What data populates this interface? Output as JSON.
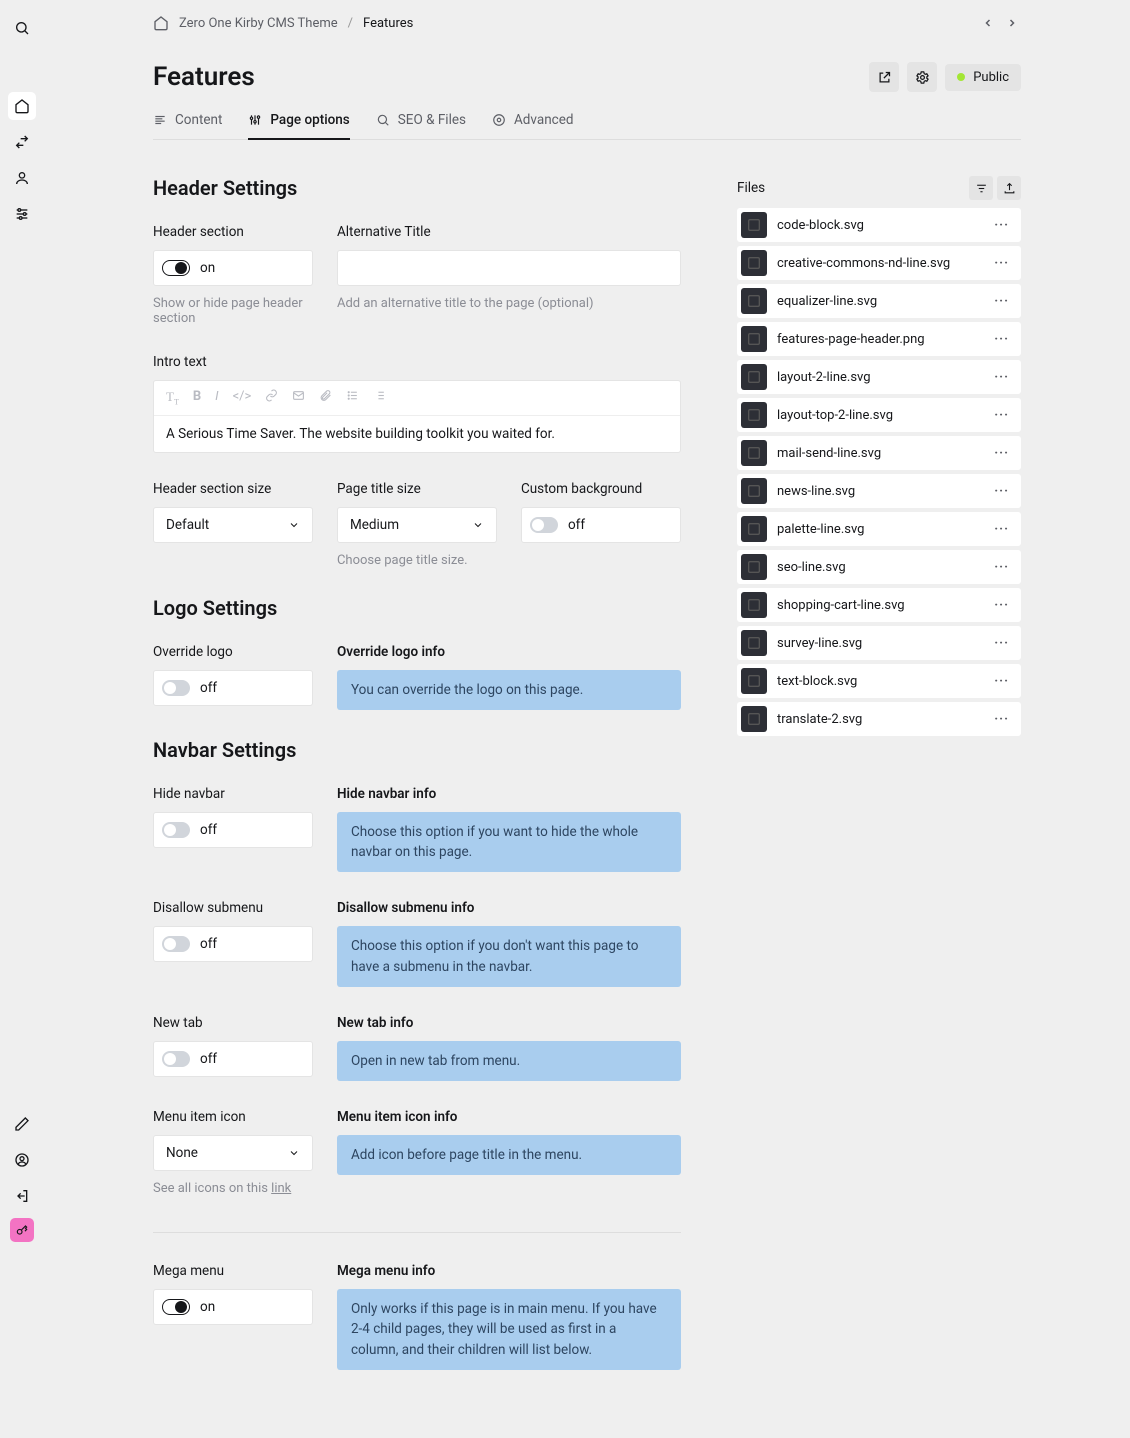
{
  "breadcrumb": {
    "root": "Zero One Kirby CMS Theme",
    "current": "Features"
  },
  "page": {
    "title": "Features",
    "status": "Public"
  },
  "tabs": [
    {
      "label": "Content"
    },
    {
      "label": "Page options"
    },
    {
      "label": "SEO & Files"
    },
    {
      "label": "Advanced"
    }
  ],
  "header_settings": {
    "heading": "Header Settings",
    "header_section": {
      "label": "Header section",
      "value": "on",
      "help": "Show or hide page header section"
    },
    "alt_title": {
      "label": "Alternative Title",
      "value": "",
      "help": "Add an alternative title to the page (optional)"
    },
    "intro": {
      "label": "Intro text",
      "value": "A Serious Time Saver. The website building toolkit you waited for."
    },
    "section_size": {
      "label": "Header section size",
      "value": "Default"
    },
    "title_size": {
      "label": "Page title size",
      "value": "Medium",
      "help": "Choose page title size."
    },
    "custom_bg": {
      "label": "Custom background",
      "value": "off"
    }
  },
  "logo_settings": {
    "heading": "Logo Settings",
    "override": {
      "label": "Override logo",
      "value": "off"
    },
    "info": {
      "label": "Override logo info",
      "text": "You can override the logo on this page."
    }
  },
  "navbar_settings": {
    "heading": "Navbar Settings",
    "hide": {
      "label": "Hide navbar",
      "value": "off",
      "info_label": "Hide navbar info",
      "info_text": "Choose this option if you want to hide the whole navbar on this page."
    },
    "disallow_submenu": {
      "label": "Disallow submenu",
      "value": "off",
      "info_label": "Disallow submenu info",
      "info_text": "Choose this option if you don't want this page to have a submenu in the navbar."
    },
    "new_tab": {
      "label": "New tab",
      "value": "off",
      "info_label": "New tab info",
      "info_text": "Open in new tab from menu."
    },
    "menu_icon": {
      "label": "Menu item icon",
      "value": "None",
      "help_prefix": "See all icons on this ",
      "help_link": "link",
      "info_label": "Menu item icon info",
      "info_text": "Add icon before page title in the menu."
    },
    "mega_menu": {
      "label": "Mega menu",
      "value": "on",
      "info_label": "Mega menu info",
      "info_text": "Only works if this page is in main menu. If you have 2-4 child pages, they will be used as first in a column, and their children will list below."
    }
  },
  "files": {
    "heading": "Files",
    "items": [
      {
        "name": "code-block.svg"
      },
      {
        "name": "creative-commons-nd-line.svg"
      },
      {
        "name": "equalizer-line.svg"
      },
      {
        "name": "features-page-header.png"
      },
      {
        "name": "layout-2-line.svg"
      },
      {
        "name": "layout-top-2-line.svg"
      },
      {
        "name": "mail-send-line.svg"
      },
      {
        "name": "news-line.svg"
      },
      {
        "name": "palette-line.svg"
      },
      {
        "name": "seo-line.svg"
      },
      {
        "name": "shopping-cart-line.svg"
      },
      {
        "name": "survey-line.svg"
      },
      {
        "name": "text-block.svg"
      },
      {
        "name": "translate-2.svg"
      }
    ]
  }
}
